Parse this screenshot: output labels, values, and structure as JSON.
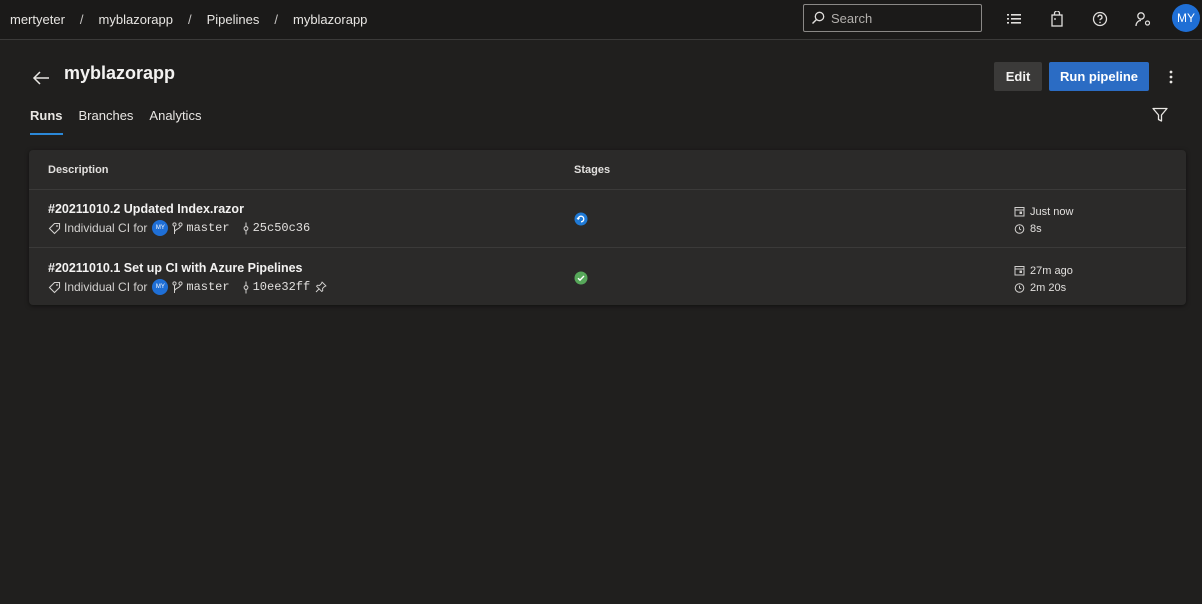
{
  "breadcrumb": {
    "org": "mertyeter",
    "project": "myblazorapp",
    "section": "Pipelines",
    "pipeline": "myblazorapp",
    "separator": "/"
  },
  "search": {
    "placeholder": "Search"
  },
  "user": {
    "initials": "MY"
  },
  "header": {
    "title": "myblazorapp",
    "edit_label": "Edit",
    "run_label": "Run pipeline"
  },
  "tabs": [
    {
      "label": "Runs",
      "active": true
    },
    {
      "label": "Branches",
      "active": false
    },
    {
      "label": "Analytics",
      "active": false
    }
  ],
  "table": {
    "columns": {
      "description": "Description",
      "stages": "Stages"
    },
    "rows": [
      {
        "title": "#20211010.2 Updated Index.razor",
        "trigger": "Individual CI for",
        "avatar": "MY",
        "branch": "master",
        "commit": "25c50c36",
        "stage_status": "running",
        "when": "Just now",
        "duration": "8s",
        "pinned": false
      },
      {
        "title": "#20211010.1 Set up CI with Azure Pipelines",
        "trigger": "Individual CI for",
        "avatar": "MY",
        "branch": "master",
        "commit": "10ee32ff",
        "stage_status": "succeeded",
        "when": "27m ago",
        "duration": "2m 20s",
        "pinned": true
      }
    ]
  },
  "colors": {
    "accent": "#2b6cc4",
    "running": "#1f7ad6",
    "success": "#57a85a",
    "background": "#201f1e"
  },
  "icons": [
    "search-icon",
    "list-icon",
    "shopping-bag-icon",
    "help-icon",
    "user-settings-icon",
    "back-arrow-icon",
    "more-vertical-icon",
    "filter-icon",
    "tag-icon",
    "branch-icon",
    "commit-icon",
    "pin-icon",
    "calendar-icon",
    "clock-icon",
    "running-icon",
    "success-icon"
  ]
}
